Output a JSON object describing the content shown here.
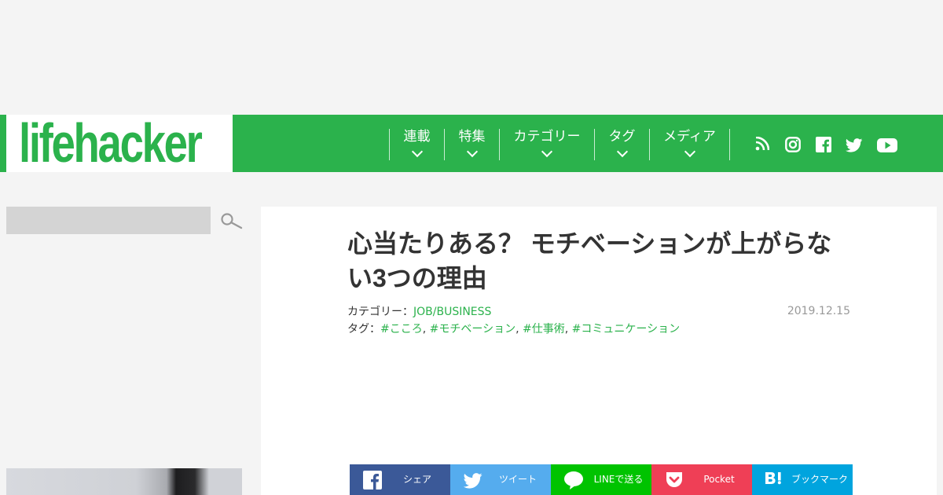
{
  "header": {
    "logo": "lifehacker",
    "nav": [
      {
        "label": "連載"
      },
      {
        "label": "特集"
      },
      {
        "label": "カテゴリー"
      },
      {
        "label": "タグ"
      },
      {
        "label": "メディア"
      }
    ],
    "social_icons": [
      "rss-icon",
      "instagram-icon",
      "facebook-icon",
      "twitter-icon",
      "youtube-icon"
    ],
    "brand_color": "#2bb24c"
  },
  "sidebar": {
    "search": {
      "value": "",
      "placeholder": ""
    }
  },
  "article": {
    "title": "心当たりある？ モチベーションが上がらない3つの理由",
    "category_label": "カテゴリー：",
    "category": "JOB/BUSINESS",
    "tags_label": "タグ：",
    "tags": [
      "#こころ",
      "#モチベーション",
      "#仕事術",
      "#コミュニケーション"
    ],
    "tag_separator": ",",
    "date": "2019.12.15"
  },
  "share": [
    {
      "label": "シェア",
      "icon": "facebook-icon",
      "color": "#3b5998"
    },
    {
      "label": "ツイート",
      "icon": "twitter-icon",
      "color": "#55acee"
    },
    {
      "label": "LINEで送る",
      "icon": "line-icon",
      "color": "#00c300"
    },
    {
      "label": "Pocket",
      "icon": "pocket-icon",
      "color": "#ef3f56"
    },
    {
      "label": "ブックマーク",
      "icon": "hatena-bookmark-icon",
      "color": "#00a4de"
    }
  ]
}
